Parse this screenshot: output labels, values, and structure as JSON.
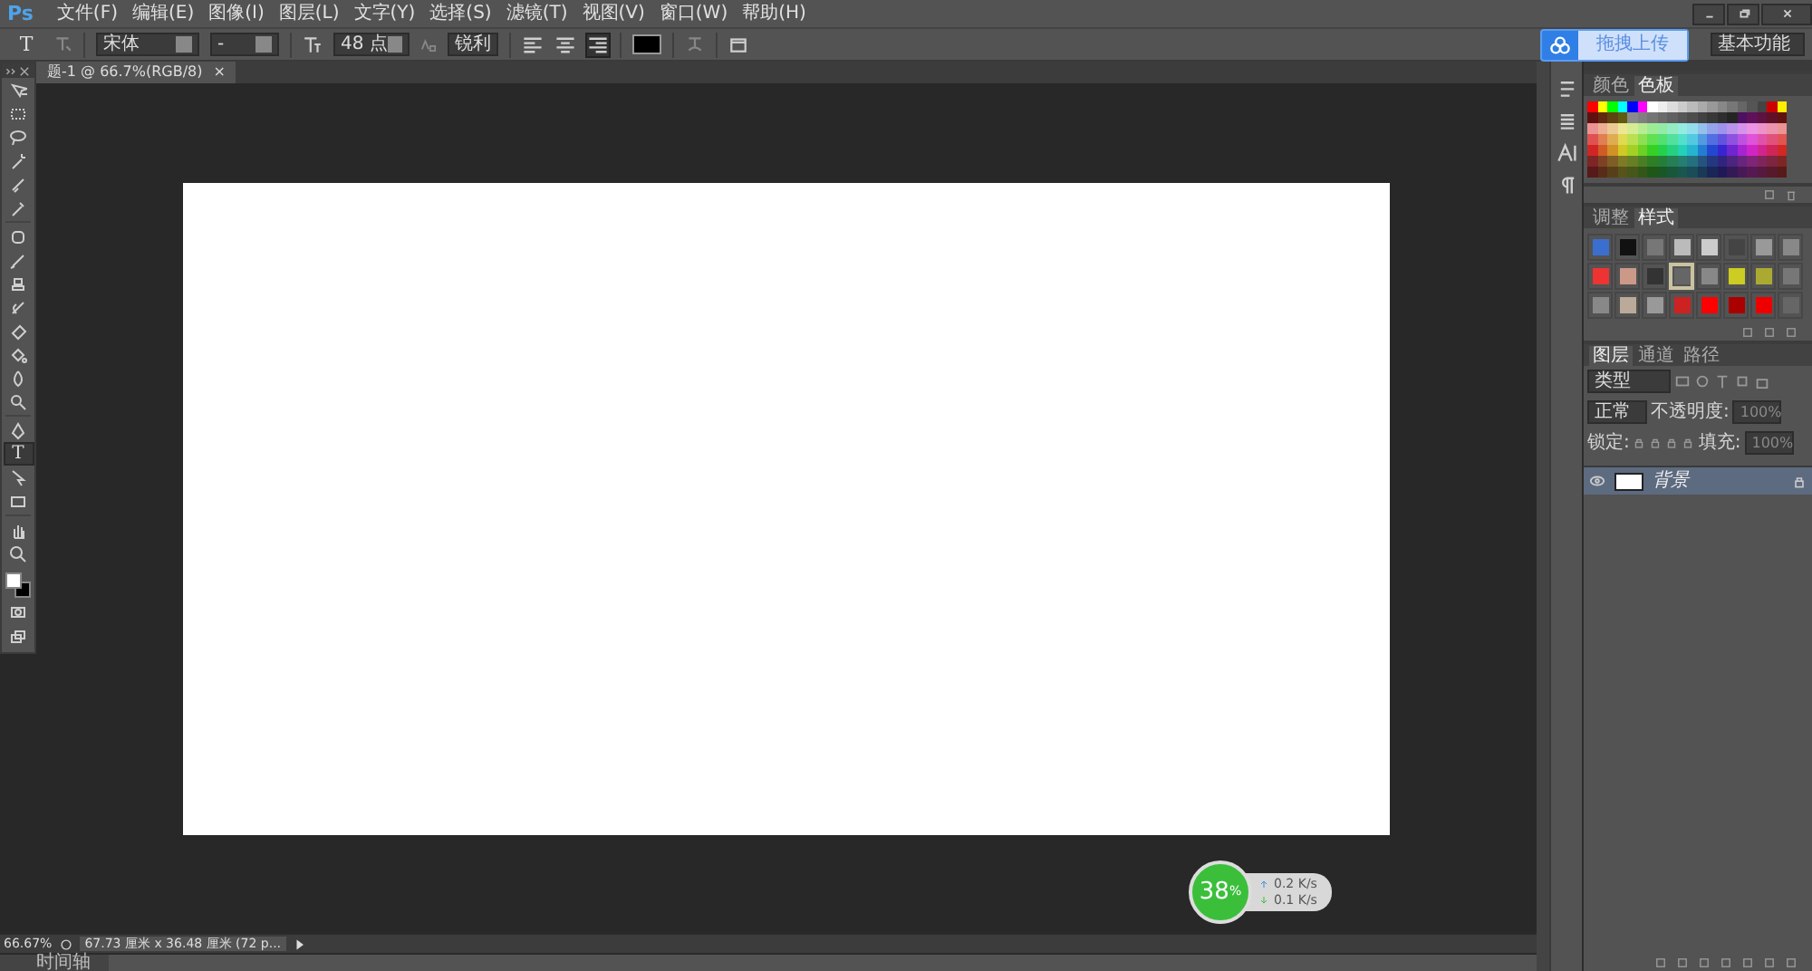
{
  "app_logo": "Ps",
  "menu": [
    "文件(F)",
    "编辑(E)",
    "图像(I)",
    "图层(L)",
    "文字(Y)",
    "选择(S)",
    "滤镜(T)",
    "视图(V)",
    "窗口(W)",
    "帮助(H)"
  ],
  "options_bar": {
    "tool_glyph": "T",
    "font_family": "宋体",
    "font_style": "-",
    "font_size": "48 点",
    "antialias": "锐利",
    "align": [
      {
        "selected": false
      },
      {
        "selected": false
      },
      {
        "selected": true
      }
    ],
    "text_swatch": {
      "color": "#000000"
    }
  },
  "upload_button": "拖拽上传",
  "workspace": "基本功能",
  "document": {
    "tab_title": "题-1 @ 66.7%(RGB/8)",
    "close": "×"
  },
  "tools": [
    {
      "kind": "move",
      "selected": false
    },
    {
      "kind": "marquee",
      "selected": false
    },
    {
      "kind": "lasso",
      "selected": false
    },
    {
      "kind": "wand",
      "selected": false
    },
    {
      "kind": "crop",
      "selected": false
    },
    {
      "kind": "eyedropper",
      "selected": false
    },
    {
      "kind": "healing",
      "selected": false
    },
    {
      "kind": "brush",
      "selected": false
    },
    {
      "kind": "stamp",
      "selected": false
    },
    {
      "kind": "history",
      "selected": false
    },
    {
      "kind": "eraser",
      "selected": false
    },
    {
      "kind": "bucket",
      "selected": false
    },
    {
      "kind": "blur",
      "selected": false
    },
    {
      "kind": "dodge",
      "selected": false
    },
    {
      "kind": "pen",
      "selected": false
    },
    {
      "kind": "text",
      "glyph": "T",
      "selected": true
    },
    {
      "kind": "path",
      "selected": false
    },
    {
      "kind": "shape",
      "selected": false
    },
    {
      "kind": "hand",
      "selected": false
    },
    {
      "kind": "zoom",
      "selected": false
    }
  ],
  "color_swatches": [
    {
      "kind": "foreground",
      "color": "#ffffff"
    },
    {
      "kind": "background",
      "color": "#000000"
    }
  ],
  "net_monitor": {
    "percent": "38",
    "unit": "%",
    "upload": "0.2 K/s",
    "download": "0.1 K/s"
  },
  "status_bar": {
    "zoom": "66.67%",
    "doc_info": "67.73 厘米 x 36.48 厘米 (72 p..."
  },
  "timeline_tab": "时间轴",
  "swatches_panel": {
    "tabs": [
      {
        "label": "颜色",
        "selected": false
      },
      {
        "label": "色板",
        "selected": true
      }
    ]
  },
  "styles_panel": {
    "tabs": [
      {
        "label": "调整",
        "selected": false
      },
      {
        "label": "样式",
        "selected": true
      }
    ],
    "presets": [
      {
        "selected": false
      },
      {
        "selected": false
      },
      {
        "selected": false
      },
      {
        "selected": false
      },
      {
        "selected": false
      },
      {
        "selected": false
      },
      {
        "selected": false
      },
      {
        "selected": false
      },
      {
        "selected": false
      },
      {
        "selected": false
      },
      {
        "selected": false
      },
      {
        "selected": true
      },
      {
        "selected": false
      },
      {
        "selected": false
      },
      {
        "selected": false
      },
      {
        "selected": false
      },
      {
        "selected": false
      },
      {
        "selected": false
      },
      {
        "selected": false
      },
      {
        "selected": false
      },
      {
        "selected": false
      },
      {
        "selected": false
      },
      {
        "selected": false
      },
      {
        "selected": false
      }
    ]
  },
  "layers_panel": {
    "tabs": [
      {
        "label": "图层",
        "selected": true
      },
      {
        "label": "通道",
        "selected": false
      },
      {
        "label": "路径",
        "selected": false
      }
    ],
    "filter": "类型",
    "blend_mode": "正常",
    "opacity_label": "不透明度:",
    "opacity": "100%",
    "lock_label": "锁定:",
    "fill_label": "填充:",
    "fill": "100%",
    "layers": [
      {
        "name": "背景",
        "visible": true,
        "selected": true,
        "locked": true
      }
    ]
  }
}
